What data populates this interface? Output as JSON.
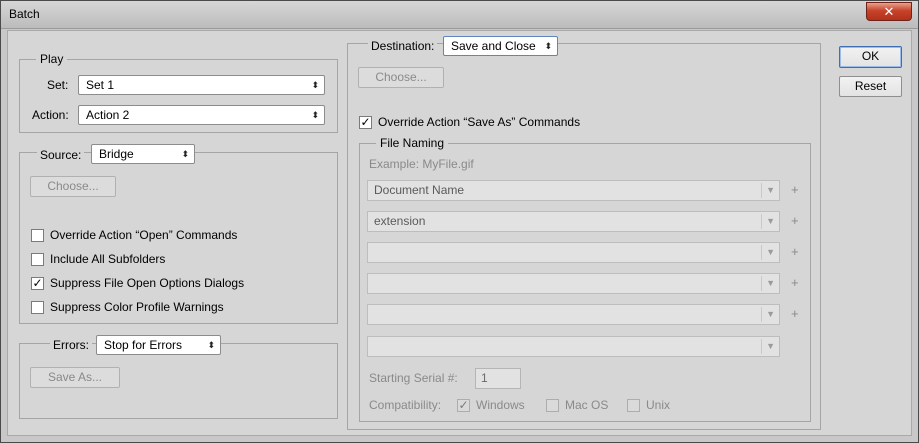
{
  "window": {
    "title": "Batch",
    "close_symbol": "✕"
  },
  "play": {
    "legend": "Play",
    "set_label": "Set:",
    "set_value": "Set 1",
    "action_label": "Action:",
    "action_value": "Action 2"
  },
  "source": {
    "label": "Source:",
    "value": "Bridge",
    "choose_label": "Choose...",
    "options": [
      {
        "label": "Override Action “Open” Commands",
        "checked": false
      },
      {
        "label": "Include All Subfolders",
        "checked": false
      },
      {
        "label": "Suppress File Open Options Dialogs",
        "checked": true
      },
      {
        "label": "Suppress Color Profile Warnings",
        "checked": false
      }
    ]
  },
  "errors": {
    "label": "Errors:",
    "value": "Stop for Errors",
    "save_as_label": "Save As..."
  },
  "destination": {
    "label": "Destination:",
    "value": "Save and Close",
    "choose_label": "Choose...",
    "override_label": "Override Action “Save As” Commands",
    "override_checked": true
  },
  "file_naming": {
    "legend": "File Naming",
    "example": "Example: MyFile.gif",
    "fields": [
      "Document Name",
      "extension",
      "",
      "",
      "",
      ""
    ],
    "plus_symbol": "+",
    "serial_label": "Starting Serial #:",
    "serial_value": "1",
    "compat_label": "Compatibility:",
    "compat_options": [
      {
        "label": "Windows",
        "checked": true
      },
      {
        "label": "Mac OS",
        "checked": false
      },
      {
        "label": "Unix",
        "checked": false
      }
    ]
  },
  "buttons": {
    "ok": "OK",
    "reset": "Reset"
  },
  "icons": {
    "dropdown": "updown-arrows-icon",
    "check": "checkmark-icon"
  }
}
